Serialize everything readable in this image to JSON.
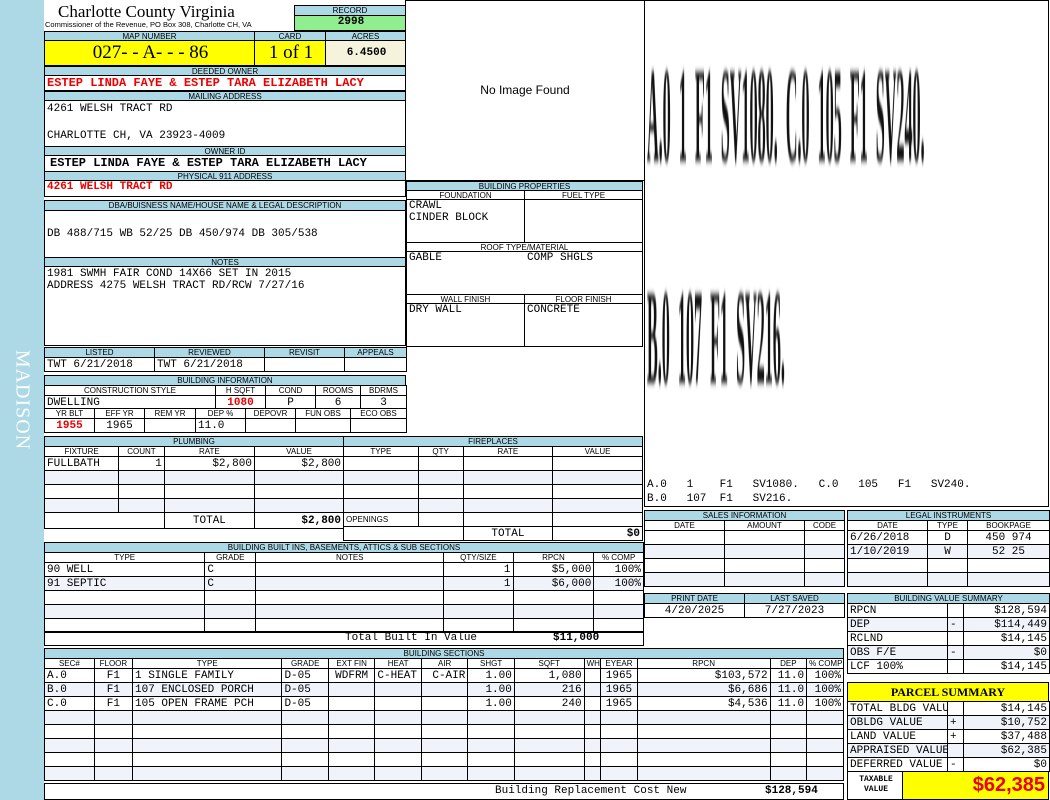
{
  "sidebar": {
    "label": "MADISON"
  },
  "header": {
    "title": "Charlotte County Virginia",
    "subtitle": "Commissioner of the Revenue, PO Box 308, Charlotte CH, VA",
    "record_label": "RECORD",
    "record": "2998"
  },
  "parcel": {
    "map_label": "MAP NUMBER",
    "map": "027- - A- - - 86",
    "card_label": "CARD",
    "card": "1 of 1",
    "acres_label": "ACRES",
    "acres": "6.4500"
  },
  "owner": {
    "deeded_label": "DEEDED OWNER",
    "deeded": "ESTEP LINDA FAYE & ESTEP TARA ELIZABETH LACY",
    "mailing_label": "MAILING ADDRESS",
    "mailing1": "4261 WELSH TRACT RD",
    "mailing2": "CHARLOTTE CH, VA 23923-4009",
    "ownerid_label": "OWNER ID",
    "ownerid": "ESTEP LINDA FAYE & ESTEP TARA ELIZABETH LACY",
    "physical_label": "PHYSICAL 911 ADDRESS",
    "physical": "4261 WELSH TRACT RD"
  },
  "legal": {
    "label": "DBA/BUISNESS NAME/HOUSE NAME & LEGAL DESCRIPTION",
    "text": "DB 488/715 WB 52/25 DB 450/974 DB 305/538"
  },
  "notes": {
    "label": "NOTES",
    "line1": "1981 SWMH FAIR COND 14X66 SET IN 2015",
    "line2": "ADDRESS 4275 WELSH TRACT RD/RCW 7/27/16"
  },
  "image": {
    "text": "No Image Found"
  },
  "props": {
    "title": "BUILDING PROPERTIES",
    "foundation_label": "FOUNDATION",
    "foundation1": "CRAWL",
    "foundation2": "CINDER BLOCK",
    "fuel_label": "FUEL TYPE",
    "roof_label": "ROOF TYPE/MATERIAL",
    "roof1": "GABLE",
    "roof2": "COMP SHGLS",
    "wall_label": "WALL FINISH",
    "wall": "DRY WALL",
    "floor_label": "FLOOR FINISH",
    "floor": "CONCRETE"
  },
  "sketch": {
    "line1": "A.0  1  F1  SV1080.  C.0  105  F1  SV240.",
    "line2": "B.0  107  F1  SV216.",
    "legend1": "A.0   1    F1   SV1080.   C.0   105   F1   SV240.",
    "legend2": "B.0   107  F1   SV216."
  },
  "review": {
    "headers": [
      "LISTED",
      "REVIEWED",
      "REVISIT",
      "APPEALS"
    ],
    "rows": [
      [
        "TWT   6/21/2018",
        "TWT   6/21/2018",
        "",
        ""
      ]
    ]
  },
  "building_info": {
    "title": "BUILDING INFORMATION",
    "h1": [
      "CONSTRUCTION STYLE",
      "H SQFT",
      "COND",
      "ROOMS",
      "BDRMS"
    ],
    "v1": [
      "DWELLING",
      "1080",
      "P",
      "6",
      "3"
    ],
    "h2": [
      "YR BLT",
      "EFF YR",
      "REM YR",
      "DEP %",
      "DEPOVR",
      "FUN OBS",
      "ECO OBS"
    ],
    "v2": [
      "1955",
      "1965",
      "",
      "11.0",
      "",
      "",
      ""
    ]
  },
  "plumbing": {
    "title": "PLUMBING",
    "headers": [
      "FIXTURE",
      "COUNT",
      "RATE",
      "VALUE"
    ],
    "rows": [
      [
        "FULLBATH",
        "1",
        "$2,800",
        "$2,800"
      ],
      [
        "",
        "",
        "",
        ""
      ],
      [
        "",
        "",
        "",
        ""
      ],
      [
        "",
        "",
        "",
        ""
      ]
    ],
    "total_label": "TOTAL",
    "total": "$2,800"
  },
  "fireplaces": {
    "title": "FIREPLACES",
    "headers": [
      "TYPE",
      "QTY",
      "RATE",
      "VALUE"
    ],
    "rows": [
      [
        "",
        "",
        "",
        ""
      ],
      [
        "",
        "",
        "",
        ""
      ],
      [
        "",
        "",
        "",
        ""
      ],
      [
        "",
        "",
        "",
        ""
      ]
    ],
    "openings_label": "OPENINGS",
    "total_label": "TOTAL",
    "total": "$0"
  },
  "builtins": {
    "title": "BUILDING BUILT INS, BASEMENTS, ATTICS & SUB SECTIONS",
    "headers": [
      "TYPE",
      "GRADE",
      "NOTES",
      "QTY/SIZE",
      "RPCN",
      "% COMP"
    ],
    "rows": [
      [
        "90 WELL",
        "C",
        "",
        "1",
        "$5,000",
        "100%"
      ],
      [
        "91 SEPTIC",
        "C",
        "",
        "1",
        "$6,000",
        "100%"
      ],
      [
        "",
        "",
        "",
        "",
        "",
        ""
      ],
      [
        "",
        "",
        "",
        "",
        "",
        ""
      ],
      [
        "",
        "",
        "",
        "",
        "",
        ""
      ]
    ],
    "total_label": "Total Built In Value",
    "total": "$11,000"
  },
  "sections": {
    "title": "BUILDING SECTIONS",
    "headers": [
      "SEC#",
      "FLOOR",
      "TYPE",
      "GRADE",
      "EXT FIN",
      "HEAT",
      "AIR",
      "SHGT",
      "SQFT",
      "WHGT",
      "EYEAR",
      "RPCN",
      "DEP",
      "% COMP"
    ],
    "rows": [
      [
        "A.0",
        "F1",
        "1 SINGLE FAMILY",
        "D-05",
        "WDFRM",
        "C-HEAT",
        "C-AIR",
        "1.00",
        "1,080",
        "",
        "1965",
        "$103,572",
        "11.0",
        "100%"
      ],
      [
        "B.0",
        "F1",
        "107 ENCLOSED PORCH",
        "D-05",
        "",
        "",
        "",
        "1.00",
        "216",
        "",
        "1965",
        "$6,686",
        "11.0",
        "100%"
      ],
      [
        "C.0",
        "F1",
        "105 OPEN FRAME PCH",
        "D-05",
        "",
        "",
        "",
        "1.00",
        "240",
        "",
        "1965",
        "$4,536",
        "11.0",
        "100%"
      ],
      [
        "",
        "",
        "",
        "",
        "",
        "",
        "",
        "",
        "",
        "",
        "",
        "",
        "",
        ""
      ],
      [
        "",
        "",
        "",
        "",
        "",
        "",
        "",
        "",
        "",
        "",
        "",
        "",
        "",
        ""
      ],
      [
        "",
        "",
        "",
        "",
        "",
        "",
        "",
        "",
        "",
        "",
        "",
        "",
        "",
        ""
      ],
      [
        "",
        "",
        "",
        "",
        "",
        "",
        "",
        "",
        "",
        "",
        "",
        "",
        "",
        ""
      ],
      [
        "",
        "",
        "",
        "",
        "",
        "",
        "",
        "",
        "",
        "",
        "",
        "",
        "",
        ""
      ]
    ],
    "total_label": "Building Replacement Cost New",
    "total": "$128,594"
  },
  "sales": {
    "title": "SALES INFORMATION",
    "headers": [
      "DATE",
      "AMOUNT",
      "CODE"
    ],
    "rows": [
      [
        "",
        "",
        ""
      ],
      [
        "",
        "",
        ""
      ],
      [
        "",
        "",
        ""
      ],
      [
        "",
        "",
        ""
      ]
    ]
  },
  "instruments": {
    "title": "LEGAL INSTRUMENTS",
    "headers": [
      "DATE",
      "TYPE",
      "BOOKPAGE"
    ],
    "rows": [
      [
        "6/26/2018",
        "D",
        "450 974"
      ],
      [
        "1/10/2019",
        "W",
        "52 25"
      ],
      [
        "",
        "",
        ""
      ],
      [
        "",
        "",
        ""
      ]
    ]
  },
  "dates": {
    "headers": [
      "PRINT DATE",
      "LAST SAVED"
    ],
    "rows": [
      [
        "4/20/2025",
        "7/27/2023"
      ]
    ]
  },
  "value_summary": {
    "title": "BUILDING VALUE SUMMARY",
    "rows": [
      [
        "RPCN",
        "",
        "$128,594"
      ],
      [
        "DEP",
        "-",
        "$114,449"
      ],
      [
        "RCLND",
        "",
        "$14,145"
      ],
      [
        "OBS F/E",
        "-",
        "$0"
      ],
      [
        "LCF      100%",
        "",
        "$14,145"
      ]
    ]
  },
  "parcel_summary": {
    "title": "PARCEL SUMMARY",
    "rows": [
      [
        "TOTAL BLDG VALUE",
        "",
        "$14,145"
      ],
      [
        "OBLDG VALUE",
        "+",
        "$10,752"
      ],
      [
        "LAND VALUE",
        "+",
        "$37,488"
      ],
      [
        "APPRAISED VALUE",
        "",
        "$62,385"
      ],
      [
        "DEFERRED VALUE",
        "-",
        "$0"
      ]
    ],
    "taxable_label": "TAXABLE VALUE",
    "taxable": "$62,385"
  },
  "colors": {
    "header_bg": "#add8e6",
    "highlight": "#ffff00",
    "record_bg": "#90ee90",
    "alert": "#e00000"
  }
}
